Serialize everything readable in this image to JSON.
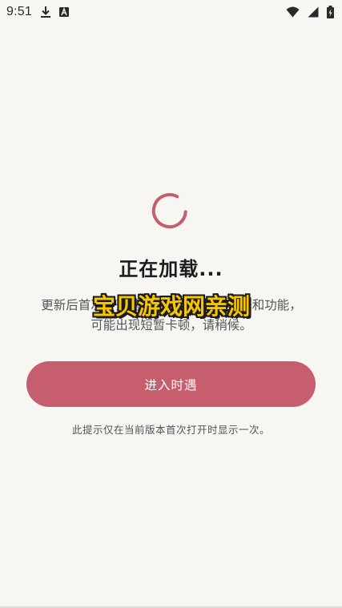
{
  "status_bar": {
    "time": "9:51",
    "icons": [
      "download-icon",
      "font-a-icon",
      "wifi-icon",
      "signal-icon",
      "battery-icon"
    ]
  },
  "loading": {
    "title": "正在加载...",
    "description": "更新后首次打开需要加载一些新的数据和功能，可能出现短暂卡顿，请稍候。",
    "spinner_color": "#c65e6e"
  },
  "watermark": {
    "text": "宝贝游戏网亲测",
    "color": "#f7c600"
  },
  "actions": {
    "enter_label": "进入时遇",
    "button_color": "#c65e6e"
  },
  "hint": {
    "text": "此提示仅在当前版本首次打开时显示一次。"
  }
}
